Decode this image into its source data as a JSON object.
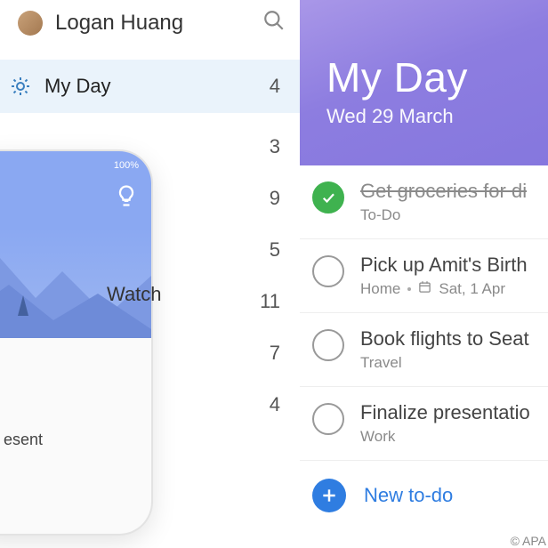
{
  "user": {
    "name": "Logan Huang"
  },
  "sidebar": {
    "my_day_label": "My Day",
    "my_day_count": "4",
    "counts": [
      "3",
      "9",
      "5",
      "11",
      "7",
      "4"
    ]
  },
  "phone": {
    "battery": "100%",
    "overflow_label": "Watch",
    "partial_tag": "esent"
  },
  "main": {
    "title": "My Day",
    "date": "Wed 29 March",
    "tasks": [
      {
        "title": "Get groceries for di",
        "sub": "To-Do",
        "done": true,
        "due": ""
      },
      {
        "title": "Pick up Amit's Birth",
        "sub": "Home",
        "done": false,
        "due": "Sat, 1 Apr"
      },
      {
        "title": "Book flights to Seat",
        "sub": "Travel",
        "done": false,
        "due": ""
      },
      {
        "title": "Finalize presentatio",
        "sub": "Work",
        "done": false,
        "due": ""
      }
    ],
    "new_label": "New to-do"
  },
  "credit": "© APA"
}
